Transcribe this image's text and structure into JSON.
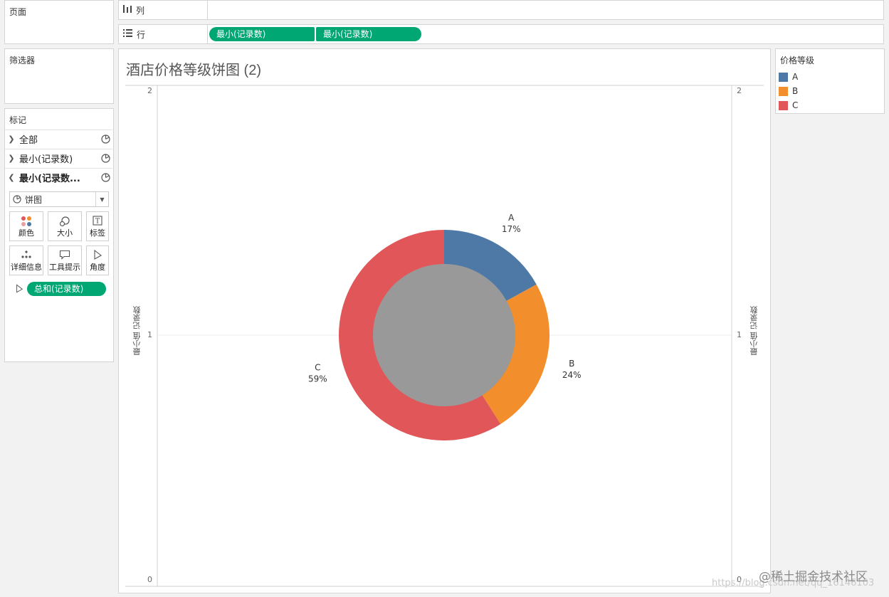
{
  "panels": {
    "pages": "页面",
    "filters": "筛选器",
    "marks": "标记"
  },
  "shelves": {
    "columns": {
      "label": "列",
      "icon": "columns-icon"
    },
    "rows": {
      "label": "行",
      "icon": "rows-icon",
      "pills": [
        "最小(记录数)",
        "最小(记录数)"
      ]
    }
  },
  "marks": {
    "rows": [
      {
        "label": "全部",
        "expanded": false
      },
      {
        "label": "最小(记录数)",
        "expanded": false
      },
      {
        "label": "最小(记录数...",
        "expanded": true
      }
    ],
    "mark_type": "饼图",
    "buttons": [
      "颜色",
      "大小",
      "标签",
      "详细信息",
      "工具提示",
      "角度"
    ],
    "angle_pill": "总和(记录数)"
  },
  "viz": {
    "title": "酒店价格等级饼图 (2)",
    "left_axis_title": "最小值 记录数",
    "right_axis_title": "最小值 记录数",
    "ticks": [
      "2",
      "1",
      "0"
    ]
  },
  "legend": {
    "title": "价格等级",
    "items": [
      {
        "label": "A",
        "color": "#4e79a7"
      },
      {
        "label": "B",
        "color": "#f28e2b"
      },
      {
        "label": "C",
        "color": "#e15759"
      }
    ]
  },
  "chart_data": {
    "type": "pie",
    "categories": [
      "A",
      "B",
      "C"
    ],
    "values": [
      17,
      24,
      59
    ],
    "labels": [
      "17%",
      "24%",
      "59%"
    ],
    "colors": [
      "#4e79a7",
      "#f28e2b",
      "#e15759"
    ],
    "inner_color": "#999999",
    "ylim": [
      0,
      2
    ]
  },
  "watermark": "@稀土掘金技术社区",
  "watermark_url": "https://blog.csdn.net/qq_16146103"
}
